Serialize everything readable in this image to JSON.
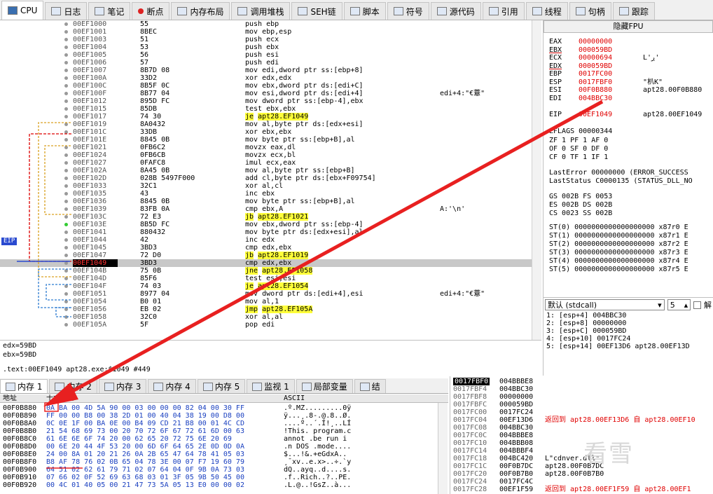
{
  "tabs": [
    {
      "label": "CPU",
      "icon": "cpu-icon"
    },
    {
      "label": "日志",
      "icon": "log-icon"
    },
    {
      "label": "笔记",
      "icon": "notes-icon"
    },
    {
      "label": "断点",
      "icon": "breakpoint-icon"
    },
    {
      "label": "内存布局",
      "icon": "memory-map-icon"
    },
    {
      "label": "调用堆栈",
      "icon": "call-stack-icon"
    },
    {
      "label": "SEH链",
      "icon": "seh-icon"
    },
    {
      "label": "脚本",
      "icon": "script-icon"
    },
    {
      "label": "符号",
      "icon": "symbols-icon"
    },
    {
      "label": "源代码",
      "icon": "source-icon"
    },
    {
      "label": "引用",
      "icon": "references-icon"
    },
    {
      "label": "线程",
      "icon": "threads-icon"
    },
    {
      "label": "句柄",
      "icon": "handles-icon"
    },
    {
      "label": "跟踪",
      "icon": "trace-icon"
    }
  ],
  "cpu_rows": [
    {
      "addr": "00EF1000",
      "bytes": "55",
      "dis": "push ebp",
      "com": ""
    },
    {
      "addr": "00EF1001",
      "bytes": "8BEC",
      "dis": "mov ebp,esp",
      "com": ""
    },
    {
      "addr": "00EF1003",
      "bytes": "51",
      "dis": "push ecx",
      "com": ""
    },
    {
      "addr": "00EF1004",
      "bytes": "53",
      "dis": "push ebx",
      "com": ""
    },
    {
      "addr": "00EF1005",
      "bytes": "56",
      "dis": "push esi",
      "com": ""
    },
    {
      "addr": "00EF1006",
      "bytes": "57",
      "dis": "push edi",
      "com": ""
    },
    {
      "addr": "00EF1007",
      "bytes": "8B7D 08",
      "dis": "mov edi,dword ptr ss:[ebp+8]",
      "com": ""
    },
    {
      "addr": "00EF100A",
      "bytes": "33D2",
      "dis": "xor edx,edx",
      "com": ""
    },
    {
      "addr": "00EF100C",
      "bytes": "8B5F 0C",
      "dis": "mov ebx,dword ptr ds:[edi+C]",
      "com": ""
    },
    {
      "addr": "00EF100F",
      "bytes": "8B77 04",
      "dis": "mov esi,dword ptr ds:[edi+4]",
      "com": "edi+4:\"€薏\""
    },
    {
      "addr": "00EF1012",
      "bytes": "895D FC",
      "dis": "mov dword ptr ss:[ebp-4],ebx",
      "com": ""
    },
    {
      "addr": "00EF1015",
      "bytes": "85DB",
      "dis": "test ebx,ebx",
      "com": ""
    },
    {
      "addr": "00EF1017",
      "bytes": "74 30",
      "dis": "je apt28.EF1049",
      "com": ""
    },
    {
      "addr": "00EF1019",
      "bytes": "8A0432",
      "dis": "mov al,byte ptr ds:[edx+esi]",
      "com": ""
    },
    {
      "addr": "00EF101C",
      "bytes": "33DB",
      "dis": "xor ebx,ebx",
      "com": ""
    },
    {
      "addr": "00EF101E",
      "bytes": "8845 0B",
      "dis": "mov byte ptr ss:[ebp+B],al",
      "com": ""
    },
    {
      "addr": "00EF1021",
      "bytes": "0FB6C2",
      "dis": "movzx eax,dl",
      "com": ""
    },
    {
      "addr": "00EF1024",
      "bytes": "0FB6CB",
      "dis": "movzx ecx,bl",
      "com": ""
    },
    {
      "addr": "00EF1027",
      "bytes": "0FAFC8",
      "dis": "imul ecx,eax",
      "com": ""
    },
    {
      "addr": "00EF102A",
      "bytes": "8A45 0B",
      "dis": "mov al,byte ptr ss:[ebp+B]",
      "com": ""
    },
    {
      "addr": "00EF102D",
      "bytes": "028B 5497F000",
      "dis": "add cl,byte ptr ds:[ebx+F09754]",
      "com": ""
    },
    {
      "addr": "00EF1033",
      "bytes": "32C1",
      "dis": "xor al,cl",
      "com": ""
    },
    {
      "addr": "00EF1035",
      "bytes": "43",
      "dis": "inc ebx",
      "com": ""
    },
    {
      "addr": "00EF1036",
      "bytes": "8845 0B",
      "dis": "mov byte ptr ss:[ebp+B],al",
      "com": ""
    },
    {
      "addr": "00EF1039",
      "bytes": "83FB 0A",
      "dis": "cmp ebx,A",
      "com": "A:'\\n'"
    },
    {
      "addr": "00EF103C",
      "bytes": "72 E3",
      "dis": "jb apt28.EF1021",
      "com": ""
    },
    {
      "addr": "00EF103E",
      "bytes": "8B5D FC",
      "dis": "mov ebx,dword ptr ss:[ebp-4]",
      "com": ""
    },
    {
      "addr": "00EF1041",
      "bytes": "880432",
      "dis": "mov byte ptr ds:[edx+esi],al",
      "com": ""
    },
    {
      "addr": "00EF1044",
      "bytes": "42",
      "dis": "inc edx",
      "com": ""
    },
    {
      "addr": "00EF1045",
      "bytes": "3BD3",
      "dis": "cmp edx,ebx",
      "com": ""
    },
    {
      "addr": "00EF1047",
      "bytes": "72 D0",
      "dis": "jb apt28.EF1019",
      "com": ""
    },
    {
      "addr": "00EF1049",
      "bytes": "3BD3",
      "dis": "cmp edx,ebx",
      "com": ""
    },
    {
      "addr": "00EF104B",
      "bytes": "75 0B",
      "dis": "jne apt28.EF1058",
      "com": ""
    },
    {
      "addr": "00EF104D",
      "bytes": "85F6",
      "dis": "test esi,esi",
      "com": ""
    },
    {
      "addr": "00EF104F",
      "bytes": "74 03",
      "dis": "je apt28.EF1054",
      "com": ""
    },
    {
      "addr": "00EF1051",
      "bytes": "8977 04",
      "dis": "mov dword ptr ds:[edi+4],esi",
      "com": "edi+4:\"€薏\""
    },
    {
      "addr": "00EF1054",
      "bytes": "B0 01",
      "dis": "mov al,1",
      "com": ""
    },
    {
      "addr": "00EF1056",
      "bytes": "EB 02",
      "dis": "jmp apt28.EF105A",
      "com": ""
    },
    {
      "addr": "00EF1058",
      "bytes": "32C0",
      "dis": "xor al,al",
      "com": ""
    },
    {
      "addr": "00EF105A",
      "bytes": "5F",
      "dis": "pop edi",
      "com": ""
    }
  ],
  "eip_label": "EIP",
  "fpu_button": "隐藏FPU",
  "registers": [
    {
      "name": "EAX",
      "value": "00000000",
      "extra": ""
    },
    {
      "name": "EBX",
      "value": "000059BD",
      "extra": ""
    },
    {
      "name": "ECX",
      "value": "00000694",
      "extra": "L'ڔ'"
    },
    {
      "name": "EDX",
      "value": "000059BD",
      "extra": ""
    },
    {
      "name": "EBP",
      "value": "0017FC00",
      "extra": ""
    },
    {
      "name": "ESP",
      "value": "0017FBF0",
      "extra": "\"朳K\""
    },
    {
      "name": "ESI",
      "value": "00F0B880",
      "extra": "apt28.00F0B880"
    },
    {
      "name": "EDI",
      "value": "004BBC30",
      "extra": ""
    },
    {
      "name": "EIP",
      "value": "00EF1049",
      "extra": "apt28.00EF1049"
    }
  ],
  "eflags": "EFLAGS   00000344",
  "flags": [
    "ZF 1  PF 1  AF 0",
    "OF 0  SF 0  DF 0",
    "CF 0  TF 1  IF 1"
  ],
  "last_error": "LastError  00000000 (ERROR_SUCCESS",
  "last_status": "LastStatus C0000135 (STATUS_DLL_NO",
  "segments": [
    "GS 002B  FS 0053",
    "ES 002B  DS 002B",
    "CS 0023  SS 002B"
  ],
  "fpu": [
    "ST(0) 0000000000000000000 x87r0 E",
    "ST(1) 0000000000000000000 x87r1 E",
    "ST(2) 0000000000000000000 x87r2 E",
    "ST(3) 0000000000000000000 x87r3 E",
    "ST(4) 0000000000000000000 x87r4 E",
    "ST(5) 0000000000000000000 x87r5 E"
  ],
  "callconv": {
    "selected": "默认 (stdcall)",
    "count": "5",
    "unlock": "解"
  },
  "args": [
    "1: [esp+4] 004BBC30",
    "2: [esp+8] 00000000",
    "3: [esp+C] 000059BD",
    "4: [esp+10] 0017FC24",
    "5: [esp+14] 00EF13D6 apt28.00EF13D"
  ],
  "info": [
    "edx=59BD",
    "ebx=59BD",
    ".text:00EF1049 apt28.exe:$1049 #449"
  ],
  "mem_tabs": [
    {
      "label": "内存 1",
      "icon": "memory-icon"
    },
    {
      "label": "内存 2",
      "icon": "memory-icon"
    },
    {
      "label": "内存 3",
      "icon": "memory-icon"
    },
    {
      "label": "内存 4",
      "icon": "memory-icon"
    },
    {
      "label": "内存 5",
      "icon": "memory-icon"
    },
    {
      "label": "监视 1",
      "icon": "watch-icon"
    },
    {
      "label": "局部变量",
      "icon": "locals-icon"
    },
    {
      "label": "结",
      "icon": "struct-icon"
    }
  ],
  "dump_header": {
    "addr": "地址",
    "hex": "十六进制",
    "ascii": "ASCII"
  },
  "dump": [
    {
      "addr": "00F0B880",
      "hex": "0A BA 00 4D 5A 90 00 03 00 00 00 82 04 00 30 FF",
      "ascii": ".º.MZ.........0ÿ"
    },
    {
      "addr": "00F0B890",
      "hex": "FF 00 00 B8 00 38 2D 01 00 40 04 38 19 00 D8 00",
      "ascii": "ÿ...¸.8-.@.8..Ø."
    },
    {
      "addr": "00F0B8A0",
      "hex": "0C 0E 1F 00 BA 0E 00 B4 09 CD 21 B8 00 01 4C CD",
      "ascii": "....º..´.Í!¸..LÍ"
    },
    {
      "addr": "00F0B8B0",
      "hex": "21 54 68 69 73 00 20 70 72 6F 67 72 61 6D 00 63",
      "ascii": "!This. program.c"
    },
    {
      "addr": "00F0B8C0",
      "hex": "61 6E 6E 6F 74 20 00 62 65 20 72 75 6E 20 69",
      "ascii": "annot .be run i"
    },
    {
      "addr": "00F0B8D0",
      "hex": "00 6E 20 44 4F 53 20 00 6D 6F 64 65 2E 0D 0D 0A",
      "ascii": ".n DOS .mode...."
    },
    {
      "addr": "00F0B8E0",
      "hex": "24 00 8A 01 20 21 26 0A 2B 65 47 64 78 41 05 03",
      "ascii": "$...!&.+eGdxA.."
    },
    {
      "addr": "00F0B8F0",
      "hex": "B8 AF 78 76 02 0B 65 04 78 3E 00 07 F7 19 60 79",
      "ascii": "¸¯xv..e.x>..÷.`y"
    },
    {
      "addr": "00F0B900",
      "hex": "64 51 02 62 61 79 71 02 07 64 04 0F 9B 0A 73 03",
      "ascii": "dQ..ayq..d....s."
    },
    {
      "addr": "00F0B910",
      "hex": "07 66 02 0F 52 69 63 68 03 01 3F 05 9B 50 45 00",
      "ascii": ".f..Rich..?..PE."
    },
    {
      "addr": "00F0B920",
      "hex": "00 4C 01 40 05 00 21 47 73 5A 05 13 E0 00 00 02",
      "ascii": ".L.@..!GsZ..à..."
    }
  ],
  "stack": [
    {
      "addr": "0017FBF0",
      "val": "004BBBE8",
      "com": "",
      "red": false
    },
    {
      "addr": "0017FBF4",
      "val": "004BBC30",
      "com": "",
      "red": false
    },
    {
      "addr": "0017FBF8",
      "val": "00000000",
      "com": "",
      "red": false
    },
    {
      "addr": "0017FBFC",
      "val": "000059BD",
      "com": "",
      "red": false
    },
    {
      "addr": "0017FC00",
      "val": "0017FC24",
      "com": "",
      "red": false
    },
    {
      "addr": "0017FC04",
      "val": "00EF13D6",
      "com": "返回到 apt28.00EF13D6 自 apt28.00EF10",
      "red": true
    },
    {
      "addr": "0017FC08",
      "val": "004BBC30",
      "com": "",
      "red": false
    },
    {
      "addr": "0017FC0C",
      "val": "004BBBE8",
      "com": "",
      "red": false
    },
    {
      "addr": "0017FC10",
      "val": "004BBB08",
      "com": "",
      "red": false
    },
    {
      "addr": "0017FC14",
      "val": "004BBBF4",
      "com": "",
      "red": false
    },
    {
      "addr": "0017FC18",
      "val": "004BC420",
      "com": "L\"cdnver.dll\"",
      "red": false
    },
    {
      "addr": "0017FC1C",
      "val": "00F0B7DC",
      "com": "apt28.00F0B7DC",
      "red": false
    },
    {
      "addr": "0017FC20",
      "val": "00F0B7B0",
      "com": "apt28.00F0B7B0",
      "red": false
    },
    {
      "addr": "0017FC24",
      "val": "0017FC4C",
      "com": "",
      "red": false
    },
    {
      "addr": "0017FC28",
      "val": "00EF1F59",
      "com": "返回到 apt28.00EF1F59 自 apt28.00EF1",
      "red": true
    }
  ],
  "watermark": "看雪",
  "colors": {
    "accent_red": "#e00000",
    "highlight_yellow": "#ffff3a",
    "hex_blue": "#1a40c0"
  }
}
